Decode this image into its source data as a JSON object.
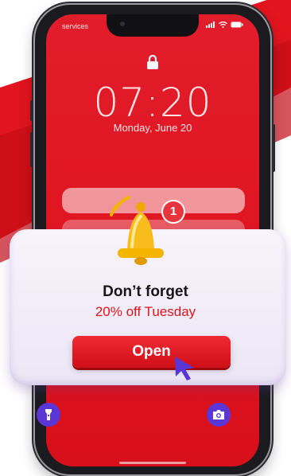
{
  "status_bar": {
    "carrier": "services"
  },
  "lock_screen": {
    "time": "07:20",
    "date": "Monday, June 20"
  },
  "notification": {
    "badge_count": "1",
    "title": "Don’t forget",
    "subtitle": "20% off Tuesday",
    "button_label": "Open"
  },
  "quick_actions": [
    "flashlight",
    "camera"
  ],
  "colors": {
    "brand_red": "#e01521",
    "accent_purple": "#5a36d6",
    "bell_gold": "#f5b400"
  }
}
